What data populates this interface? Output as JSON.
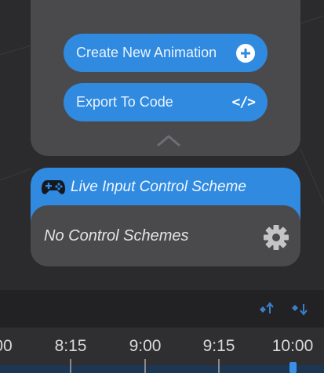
{
  "animation_panel": {
    "create_label": "Create New Animation",
    "export_label": "Export To Code",
    "export_icon_text": "</>"
  },
  "control_scheme": {
    "title": "Live Input Control Scheme",
    "empty_text": "No Control Schemes"
  },
  "timeline": {
    "ticks": [
      "00",
      "8:15",
      "9:00",
      "9:15",
      "10:00"
    ]
  },
  "colors": {
    "accent": "#2f8ae0",
    "panel": "#4a4a4d",
    "background": "#2b2b2e"
  }
}
